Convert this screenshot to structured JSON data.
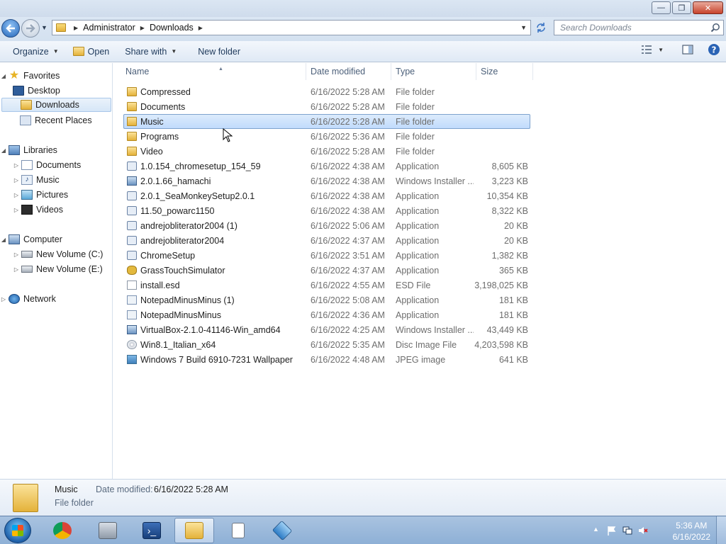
{
  "window": {
    "minimize_glyph": "—",
    "maximize_glyph": "❐",
    "close_glyph": "✕"
  },
  "address": {
    "crumbs": [
      "Administrator",
      "Downloads"
    ],
    "search_placeholder": "Search Downloads"
  },
  "toolbar": {
    "organize": "Organize",
    "open": "Open",
    "share_with": "Share with",
    "new_folder": "New folder"
  },
  "sidebar": {
    "favorites": "Favorites",
    "desktop": "Desktop",
    "downloads": "Downloads",
    "recent_places": "Recent Places",
    "libraries": "Libraries",
    "documents": "Documents",
    "music": "Music",
    "pictures": "Pictures",
    "videos": "Videos",
    "computer": "Computer",
    "volume_c": "New Volume (C:)",
    "volume_e": "New Volume (E:)",
    "network": "Network"
  },
  "columns": {
    "name": "Name",
    "date": "Date modified",
    "type": "Type",
    "size": "Size"
  },
  "files": [
    {
      "name": "Compressed",
      "date": "6/16/2022 5:28 AM",
      "type": "File folder",
      "size": "",
      "icon": "folder"
    },
    {
      "name": "Documents",
      "date": "6/16/2022 5:28 AM",
      "type": "File folder",
      "size": "",
      "icon": "folder"
    },
    {
      "name": "Music",
      "date": "6/16/2022 5:28 AM",
      "type": "File folder",
      "size": "",
      "icon": "folder"
    },
    {
      "name": "Programs",
      "date": "6/16/2022 5:36 AM",
      "type": "File folder",
      "size": "",
      "icon": "folder"
    },
    {
      "name": "Video",
      "date": "6/16/2022 5:28 AM",
      "type": "File folder",
      "size": "",
      "icon": "folder"
    },
    {
      "name": "1.0.154_chromesetup_154_59",
      "date": "6/16/2022 4:38 AM",
      "type": "Application",
      "size": "8,605 KB",
      "icon": "app"
    },
    {
      "name": "2.0.1.66_hamachi",
      "date": "6/16/2022 4:38 AM",
      "type": "Windows Installer ...",
      "size": "3,223 KB",
      "icon": "installer"
    },
    {
      "name": "2.0.1_SeaMonkeySetup2.0.1",
      "date": "6/16/2022 4:38 AM",
      "type": "Application",
      "size": "10,354 KB",
      "icon": "app"
    },
    {
      "name": "11.50_powarc1150",
      "date": "6/16/2022 4:38 AM",
      "type": "Application",
      "size": "8,322 KB",
      "icon": "app"
    },
    {
      "name": "andrejobliterator2004 (1)",
      "date": "6/16/2022 5:06 AM",
      "type": "Application",
      "size": "20 KB",
      "icon": "app"
    },
    {
      "name": "andrejobliterator2004",
      "date": "6/16/2022 4:37 AM",
      "type": "Application",
      "size": "20 KB",
      "icon": "app"
    },
    {
      "name": "ChromeSetup",
      "date": "6/16/2022 3:51 AM",
      "type": "Application",
      "size": "1,382 KB",
      "icon": "app"
    },
    {
      "name": "GrassTouchSimulator",
      "date": "6/16/2022 4:37 AM",
      "type": "Application",
      "size": "365 KB",
      "icon": "glasses"
    },
    {
      "name": "install.esd",
      "date": "6/16/2022 4:55 AM",
      "type": "ESD File",
      "size": "3,198,025 KB",
      "icon": "file"
    },
    {
      "name": "NotepadMinusMinus (1)",
      "date": "6/16/2022 5:08 AM",
      "type": "Application",
      "size": "181 KB",
      "icon": "notepad"
    },
    {
      "name": "NotepadMinusMinus",
      "date": "6/16/2022 4:36 AM",
      "type": "Application",
      "size": "181 KB",
      "icon": "notepad"
    },
    {
      "name": "VirtualBox-2.1.0-41146-Win_amd64",
      "date": "6/16/2022 4:25 AM",
      "type": "Windows Installer ...",
      "size": "43,449 KB",
      "icon": "installer"
    },
    {
      "name": "Win8.1_Italian_x64",
      "date": "6/16/2022 5:35 AM",
      "type": "Disc Image File",
      "size": "4,203,598 KB",
      "icon": "disc"
    },
    {
      "name": "Windows 7 Build 6910-7231 Wallpaper",
      "date": "6/16/2022 4:48 AM",
      "type": "JPEG image",
      "size": "641 KB",
      "icon": "image"
    }
  ],
  "selected_index": 2,
  "details": {
    "name": "Music",
    "date_label": "Date modified:",
    "date_value": "6/16/2022 5:28 AM",
    "type": "File folder"
  },
  "taskbar": {
    "apps": [
      "chrome-icon",
      "server-manager-icon",
      "powershell-icon",
      "explorer-icon",
      "file-icon",
      "virtualbox-icon"
    ],
    "time": "5:36 AM",
    "date": "6/16/2022"
  }
}
